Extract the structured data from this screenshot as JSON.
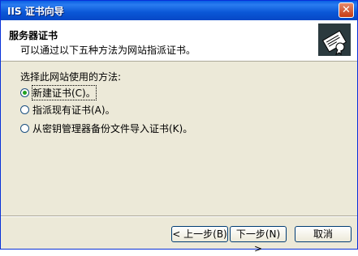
{
  "window": {
    "title": "IIS 证书向导",
    "close_symbol": "✕"
  },
  "header": {
    "title": "服务器证书",
    "subtitle": "可以通过以下五种方法为网站指派证书。",
    "icon": "certificate-icon"
  },
  "content": {
    "prompt": "选择此网站使用的方法:",
    "options": [
      {
        "label": "新建证书(C)。",
        "selected": true
      },
      {
        "label": "指派现有证书(A)。",
        "selected": false
      },
      {
        "label": "从密钥管理器备份文件导入证书(K)。",
        "selected": false
      }
    ]
  },
  "buttons": {
    "back": "< 上一步(B)",
    "next": "下一步(N) >",
    "cancel": "取消"
  }
}
